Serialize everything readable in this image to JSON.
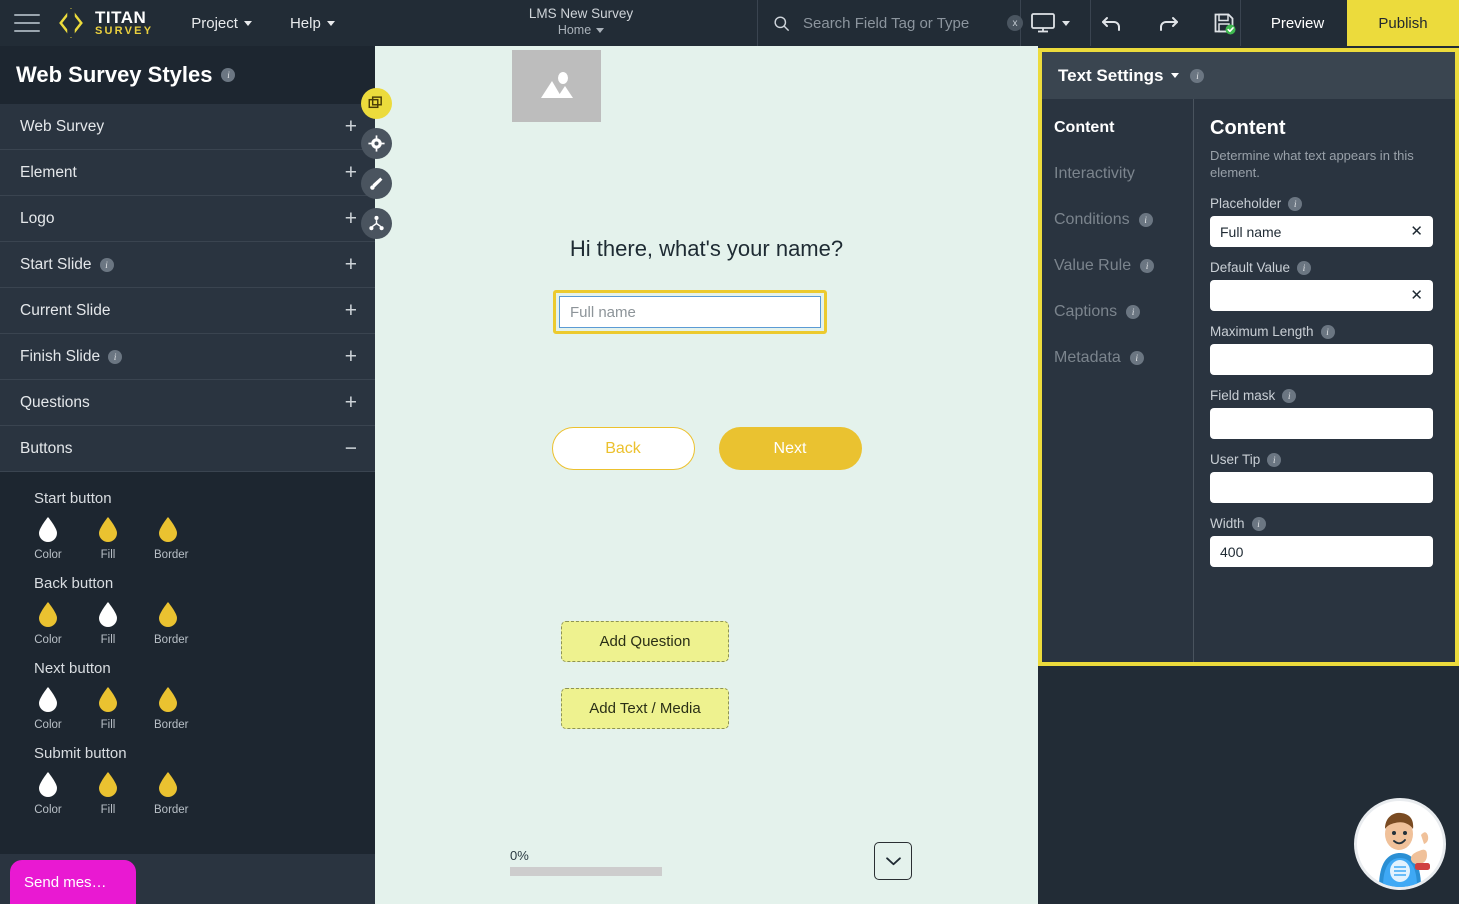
{
  "topbar": {
    "menu_icon": "hamburger-icon",
    "logo_title": "TITAN",
    "logo_sub": "SURVEY",
    "project_label": "Project",
    "help_label": "Help",
    "survey_name": "LMS New Survey",
    "home_label": "Home",
    "search_placeholder": "Search Field Tag or Type",
    "search_value": "",
    "clear_label": "x",
    "device_icon": "desktop-icon",
    "undo_icon": "undo-icon",
    "redo_icon": "redo-icon",
    "save_icon": "save-icon",
    "preview_label": "Preview",
    "publish_label": "Publish",
    "publish_color": "#ecdb3c"
  },
  "sidebar": {
    "header_title": "Web Survey Styles",
    "rows": [
      {
        "label": "Web Survey",
        "info": false,
        "control": "+"
      },
      {
        "label": "Element",
        "info": false,
        "control": "+"
      },
      {
        "label": "Logo",
        "info": false,
        "control": "+"
      },
      {
        "label": "Start Slide",
        "info": true,
        "control": "+"
      },
      {
        "label": "Current Slide",
        "info": false,
        "control": "+"
      },
      {
        "label": "Finish Slide",
        "info": true,
        "control": "+"
      },
      {
        "label": "Questions",
        "info": false,
        "control": "+"
      },
      {
        "label": "Buttons",
        "info": false,
        "control": "−"
      }
    ],
    "button_groups": [
      {
        "title": "Start button",
        "swatches": [
          {
            "label": "Color",
            "color": "#ffffff"
          },
          {
            "label": "Fill",
            "color": "#eac230"
          },
          {
            "label": "Border",
            "color": "#eac230"
          }
        ]
      },
      {
        "title": "Back button",
        "swatches": [
          {
            "label": "Color",
            "color": "#eac230"
          },
          {
            "label": "Fill",
            "color": "#ffffff"
          },
          {
            "label": "Border",
            "color": "#eac230"
          }
        ]
      },
      {
        "title": "Next button",
        "swatches": [
          {
            "label": "Color",
            "color": "#ffffff"
          },
          {
            "label": "Fill",
            "color": "#eac230"
          },
          {
            "label": "Border",
            "color": "#eac230"
          }
        ]
      },
      {
        "title": "Submit button",
        "swatches": [
          {
            "label": "Color",
            "color": "#ffffff"
          },
          {
            "label": "Fill",
            "color": "#eac230"
          },
          {
            "label": "Border",
            "color": "#eac230"
          }
        ]
      }
    ],
    "send_message_label": "Send mes…",
    "send_message_color": "#e919d2"
  },
  "rail": [
    {
      "icon": "copy-layers-icon",
      "active": true
    },
    {
      "icon": "gear-icon",
      "active": false
    },
    {
      "icon": "brush-icon",
      "active": false
    },
    {
      "icon": "share-nodes-icon",
      "active": false
    }
  ],
  "canvas": {
    "background": "#e4f2ec",
    "image_placeholder_icon": "image-placeholder-icon",
    "question_title": "Hi there, what's your name?",
    "field_placeholder": "Full name",
    "field_value": "",
    "delete_icon": "trash-icon",
    "back_label": "Back",
    "next_label": "Next",
    "add_question_label": "Add Question",
    "add_text_media_label": "Add Text / Media",
    "progress_pct": "0%",
    "progress_value": 0,
    "collapse_icon": "chevron-down-icon"
  },
  "right_panel": {
    "title": "Text Settings",
    "border_color": "#ecdb3c",
    "tabs": [
      {
        "label": "Content",
        "info": false,
        "active": true
      },
      {
        "label": "Interactivity",
        "info": false,
        "active": false
      },
      {
        "label": "Conditions",
        "info": true,
        "active": false
      },
      {
        "label": "Value Rule",
        "info": true,
        "active": false
      },
      {
        "label": "Captions",
        "info": true,
        "active": false
      },
      {
        "label": "Metadata",
        "info": true,
        "active": false
      }
    ],
    "section_title": "Content",
    "section_desc": "Determine what text appears in this element.",
    "fields": [
      {
        "label": "Placeholder",
        "info": true,
        "value": "Full name",
        "clear": true
      },
      {
        "label": "Default Value",
        "info": true,
        "value": "",
        "clear": true
      },
      {
        "label": "Maximum Length",
        "info": true,
        "value": "",
        "clear": false
      },
      {
        "label": "Field mask",
        "info": true,
        "value": "",
        "clear": false
      },
      {
        "label": "User Tip",
        "info": true,
        "value": "",
        "clear": false
      },
      {
        "label": "Width",
        "info": true,
        "value": "400",
        "clear": false
      }
    ]
  },
  "helper": {
    "icon": "support-mascot-avatar"
  }
}
